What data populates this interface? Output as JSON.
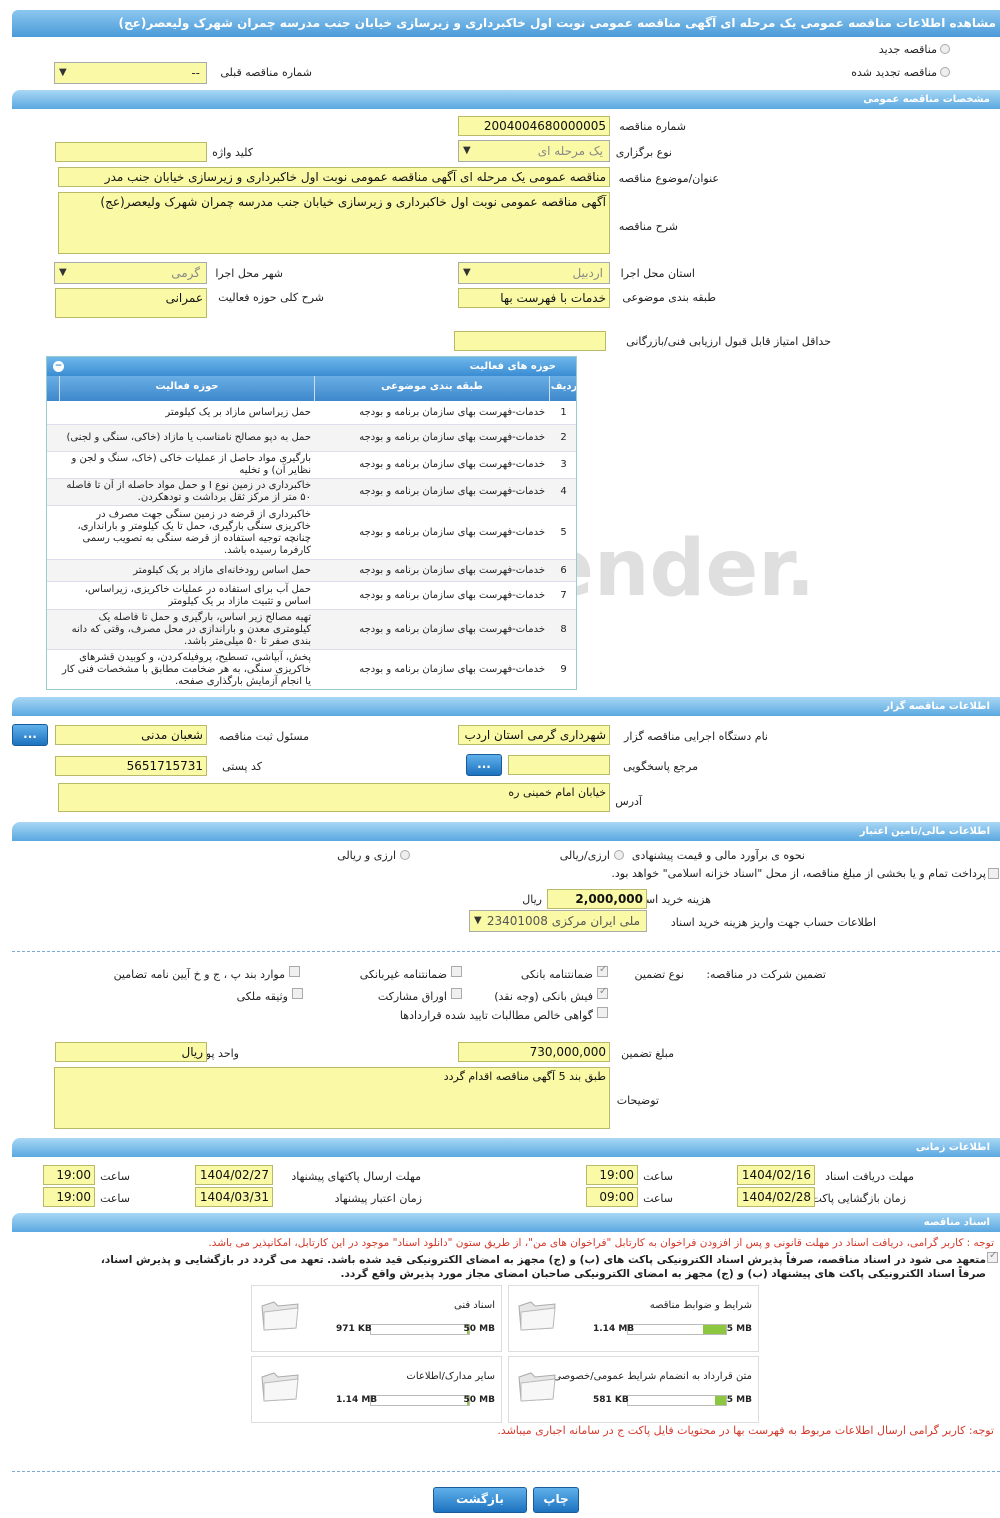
{
  "title": "مشاهده اطلاعات مناقصه عمومی یک مرحله ای آگهی مناقصه عمومی نوبت اول خاکبرداری و زیرسازی خیابان جنب مدرسه چمران شهرک ولیعصر(عج)",
  "top": {
    "new_label": "مناقصه جدید",
    "renewed_label": "مناقصه تجدید شده",
    "prev_label": "شماره مناقصه قبلی",
    "prev_value": "--"
  },
  "general": {
    "header": "مشخصات مناقصه عمومی",
    "number_label": "شماره مناقصه",
    "number": "2004004680000005",
    "type_label": "نوع برگزاری",
    "type": "یک مرحله ای",
    "keyword_label": "کلید واژه",
    "subject_label": "عنوان/موضوع مناقصه",
    "subject": "مناقصه عمومی یک مرحله ای آگهی مناقصه عمومی نوبت اول خاکبرداری و زیرسازی خیابان جنب مدر",
    "desc_label": "شرح مناقصه",
    "desc": "آگهی مناقصه عمومی نوبت اول خاکبرداری و زیرسازی خیابان جنب مدرسه چمران شهرک ولیعصر(عج)",
    "province_label": "استان محل اجرا",
    "province": "اردبیل",
    "city_label": "شهر محل اجرا",
    "city": "گرمی",
    "category_label": "طبقه بندی موضوعی",
    "category": "خدمات با فهرست بها",
    "scope_label": "شرح کلی حوزه فعالیت",
    "scope": "عمرانی",
    "min_score_label": "حداقل امتیاز قابل قبول ارزیابی فنی/بازرگانی"
  },
  "activity": {
    "header": "حوزه های فعالیت",
    "cols": [
      "ردیف",
      "طبقه بندی موضوعی",
      "حوزه فعالیت"
    ],
    "rows": [
      {
        "n": "1",
        "t": "خدمات-فهرست بهای سازمان برنامه و بودجه",
        "a": "حمل زیراساس مازاد بر یک کیلومتر"
      },
      {
        "n": "2",
        "t": "خدمات-فهرست بهای سازمان برنامه و بودجه",
        "a": "حمل به دپو مصالح نامناسب یا مازاد (خاکی، سنگی و لجنی)"
      },
      {
        "n": "3",
        "t": "خدمات-فهرست بهای سازمان برنامه و بودجه",
        "a": "بارگیری مواد حاصل از عملیات خاکی (خاک، سنگ و لجن و نظایر آن) و تخلیه"
      },
      {
        "n": "4",
        "t": "خدمات-فهرست بهای سازمان برنامه و بودجه",
        "a": "خاکبرداری در زمین نوع I و حمل مواد حاصله از آن تا فاصله ۵۰ متر از مرکز ثقل برداشت و تودهکردن."
      },
      {
        "n": "5",
        "t": "خدمات-فهرست بهای سازمان برنامه و بودجه",
        "a": "خاکبرداری از قرضه در زمین سنگی جهت مصرف در خاکریزی سنگی بارگیری، حمل تا یک کیلومتر و بارانداری، چنانچه توجیه استفاده از قرضه سنگی به تصویب رسمی کارفرما رسیده باشد."
      },
      {
        "n": "6",
        "t": "خدمات-فهرست بهای سازمان برنامه و بودجه",
        "a": "حمل اساس رودخانه‌ای مازاد بر یک کیلومتر"
      },
      {
        "n": "7",
        "t": "خدمات-فهرست بهای سازمان برنامه و بودجه",
        "a": "حمل آب برای استفاده در عملیات خاکریزی، زیراساس، اساس و تثبیت مازاد بر یک کیلومتر"
      },
      {
        "n": "8",
        "t": "خدمات-فهرست بهای سازمان برنامه و بودجه",
        "a": "تهیه مصالح زیر اساس، بارگیری و حمل تا فاصله یک کیلومتری معدن و باراندازی در محل مصرف، وقتی که دانه بندی صفر تا ۵۰ میلی‌متر باشد."
      },
      {
        "n": "9",
        "t": "خدمات-فهرست بهای سازمان برنامه و بودجه",
        "a": "پخش، آبپاشی، تسطیح، پروفیله‌کردن، و کوبیدن قشرهای خاکریزی سنگی، به هر ضخامت مطابق با مشخصات فنی کار یا انجام آزمایش بارگذاری صفحه."
      }
    ]
  },
  "organizer": {
    "header": "اطلاعات مناقصه گزار",
    "org_label": "نام دستگاه اجرایی مناقصه گزار",
    "org": "شهرداری گرمی استان اردب",
    "resp_label": "مسئول ثبت مناقصه",
    "resp": "شعبان مدنی",
    "ref_label": "مرجع پاسخگویی",
    "postal_label": "کد پستی",
    "postal": "5651715731",
    "addr_label": "آدرس",
    "addr": "خیابان امام خمینی ره",
    "btn": "..."
  },
  "finance": {
    "header": "اطلاعات مالی/تامین اعتبار",
    "method_label": "نحوه ی برآورد مالی و قیمت پیشنهادی",
    "opt1": "ارزی/ریالی",
    "opt2": "ارزی و ریالی",
    "treasury": "پرداخت تمام و یا بخشی از مبلغ مناقصه، از محل \"اسناد خزانه اسلامی\" خواهد بود.",
    "fee_label": "هزینه خرید اسناد",
    "fee": "2,000,000",
    "fee_unit": "ریال",
    "acct_label": "اطلاعات حساب جهت واریز هزینه خرید اسناد",
    "acct": "ملی ایران مرکزی 23401008"
  },
  "guarantee": {
    "label": "تضمین شرکت در مناقصه:",
    "type_label": "نوع تضمین",
    "bank": "ضمانتنامه بانکی",
    "nonbank": "ضمانتنامه غیربانکی",
    "clauses": "موارد بند پ ، ج و خ آیین نامه تضامین",
    "fish": "فیش بانکی (وجه نقد)",
    "bonds": "اوراق مشارکت",
    "property": "وثیقه ملکی",
    "cert": "گواهی خالص مطالبات تایید شده قراردادها",
    "amount_label": "مبلغ تضمین",
    "amount": "730,000,000",
    "currency_label": "واحد پول",
    "currency": "ریال",
    "notes_label": "توضیحات",
    "notes": "طبق بند 5 آگهی مناقصه اقدام گردد"
  },
  "schedule": {
    "header": "اطلاعات زمانی",
    "recv_label": "مهلت دریافت اسناد",
    "recv_date": "1404/02/16",
    "recv_time": "19:00",
    "send_label": "مهلت ارسال پاکتهای پیشنهاد",
    "send_date": "1404/02/27",
    "send_time": "19:00",
    "open_label": "زمان بازگشایی پاکت ها",
    "open_date": "1404/02/28",
    "open_time": "09:00",
    "valid_label": "زمان اعتبار پیشنهاد",
    "valid_date": "1404/03/31",
    "valid_time": "19:00",
    "time_label": "ساعت"
  },
  "docs": {
    "header": "اسناد مناقصه",
    "note1": "توجه : کاربر گرامی، دریافت اسناد در مهلت قانونی و پس از افزودن فراخوان به کارتابل \"فراخوان های من\"، از طریق ستون \"دانلود اسناد\" موجود در این کارتابل، امکانپذیر می باشد.",
    "commit1": "متعهد می شود در اسناد مناقصه، صرفاً پذیرش اسناد الکترونیکی پاکت های (ب) و (ج) مجهز به امضای الکترونیکی قید شده باشد. تعهد می گردد در بازگشایی و پذیرش اسناد،",
    "commit2": "صرفاً اسناد الکترونیکی پاکت های پیشنهاد (ب) و (ج) مجهز به امضای الکترونیکی صاحبان امضای مجاز مورد پذیرش واقع گردد.",
    "files": [
      {
        "name": "شرایط و ضوابط مناقصه",
        "size": "1.14 MB",
        "max": "5 MB",
        "pct": 23
      },
      {
        "name": "اسناد فنی",
        "size": "971 KB",
        "max": "50 MB",
        "pct": 2
      },
      {
        "name": "متن قرارداد به انضمام شرایط عمومی/خصوصی",
        "size": "581 KB",
        "max": "5 MB",
        "pct": 11
      },
      {
        "name": "سایر مدارک/اطلاعات",
        "size": "1.14 MB",
        "max": "50 MB",
        "pct": 2
      }
    ],
    "note2": "توجه: کاربر گرامی ارسال اطلاعات مربوط به فهرست بها در محتویات فایل پاکت ج در سامانه اجباری میباشد."
  },
  "actions": {
    "back": "بازگشت",
    "print": "چاپ"
  },
  "watermark": "AriaTender.neT"
}
